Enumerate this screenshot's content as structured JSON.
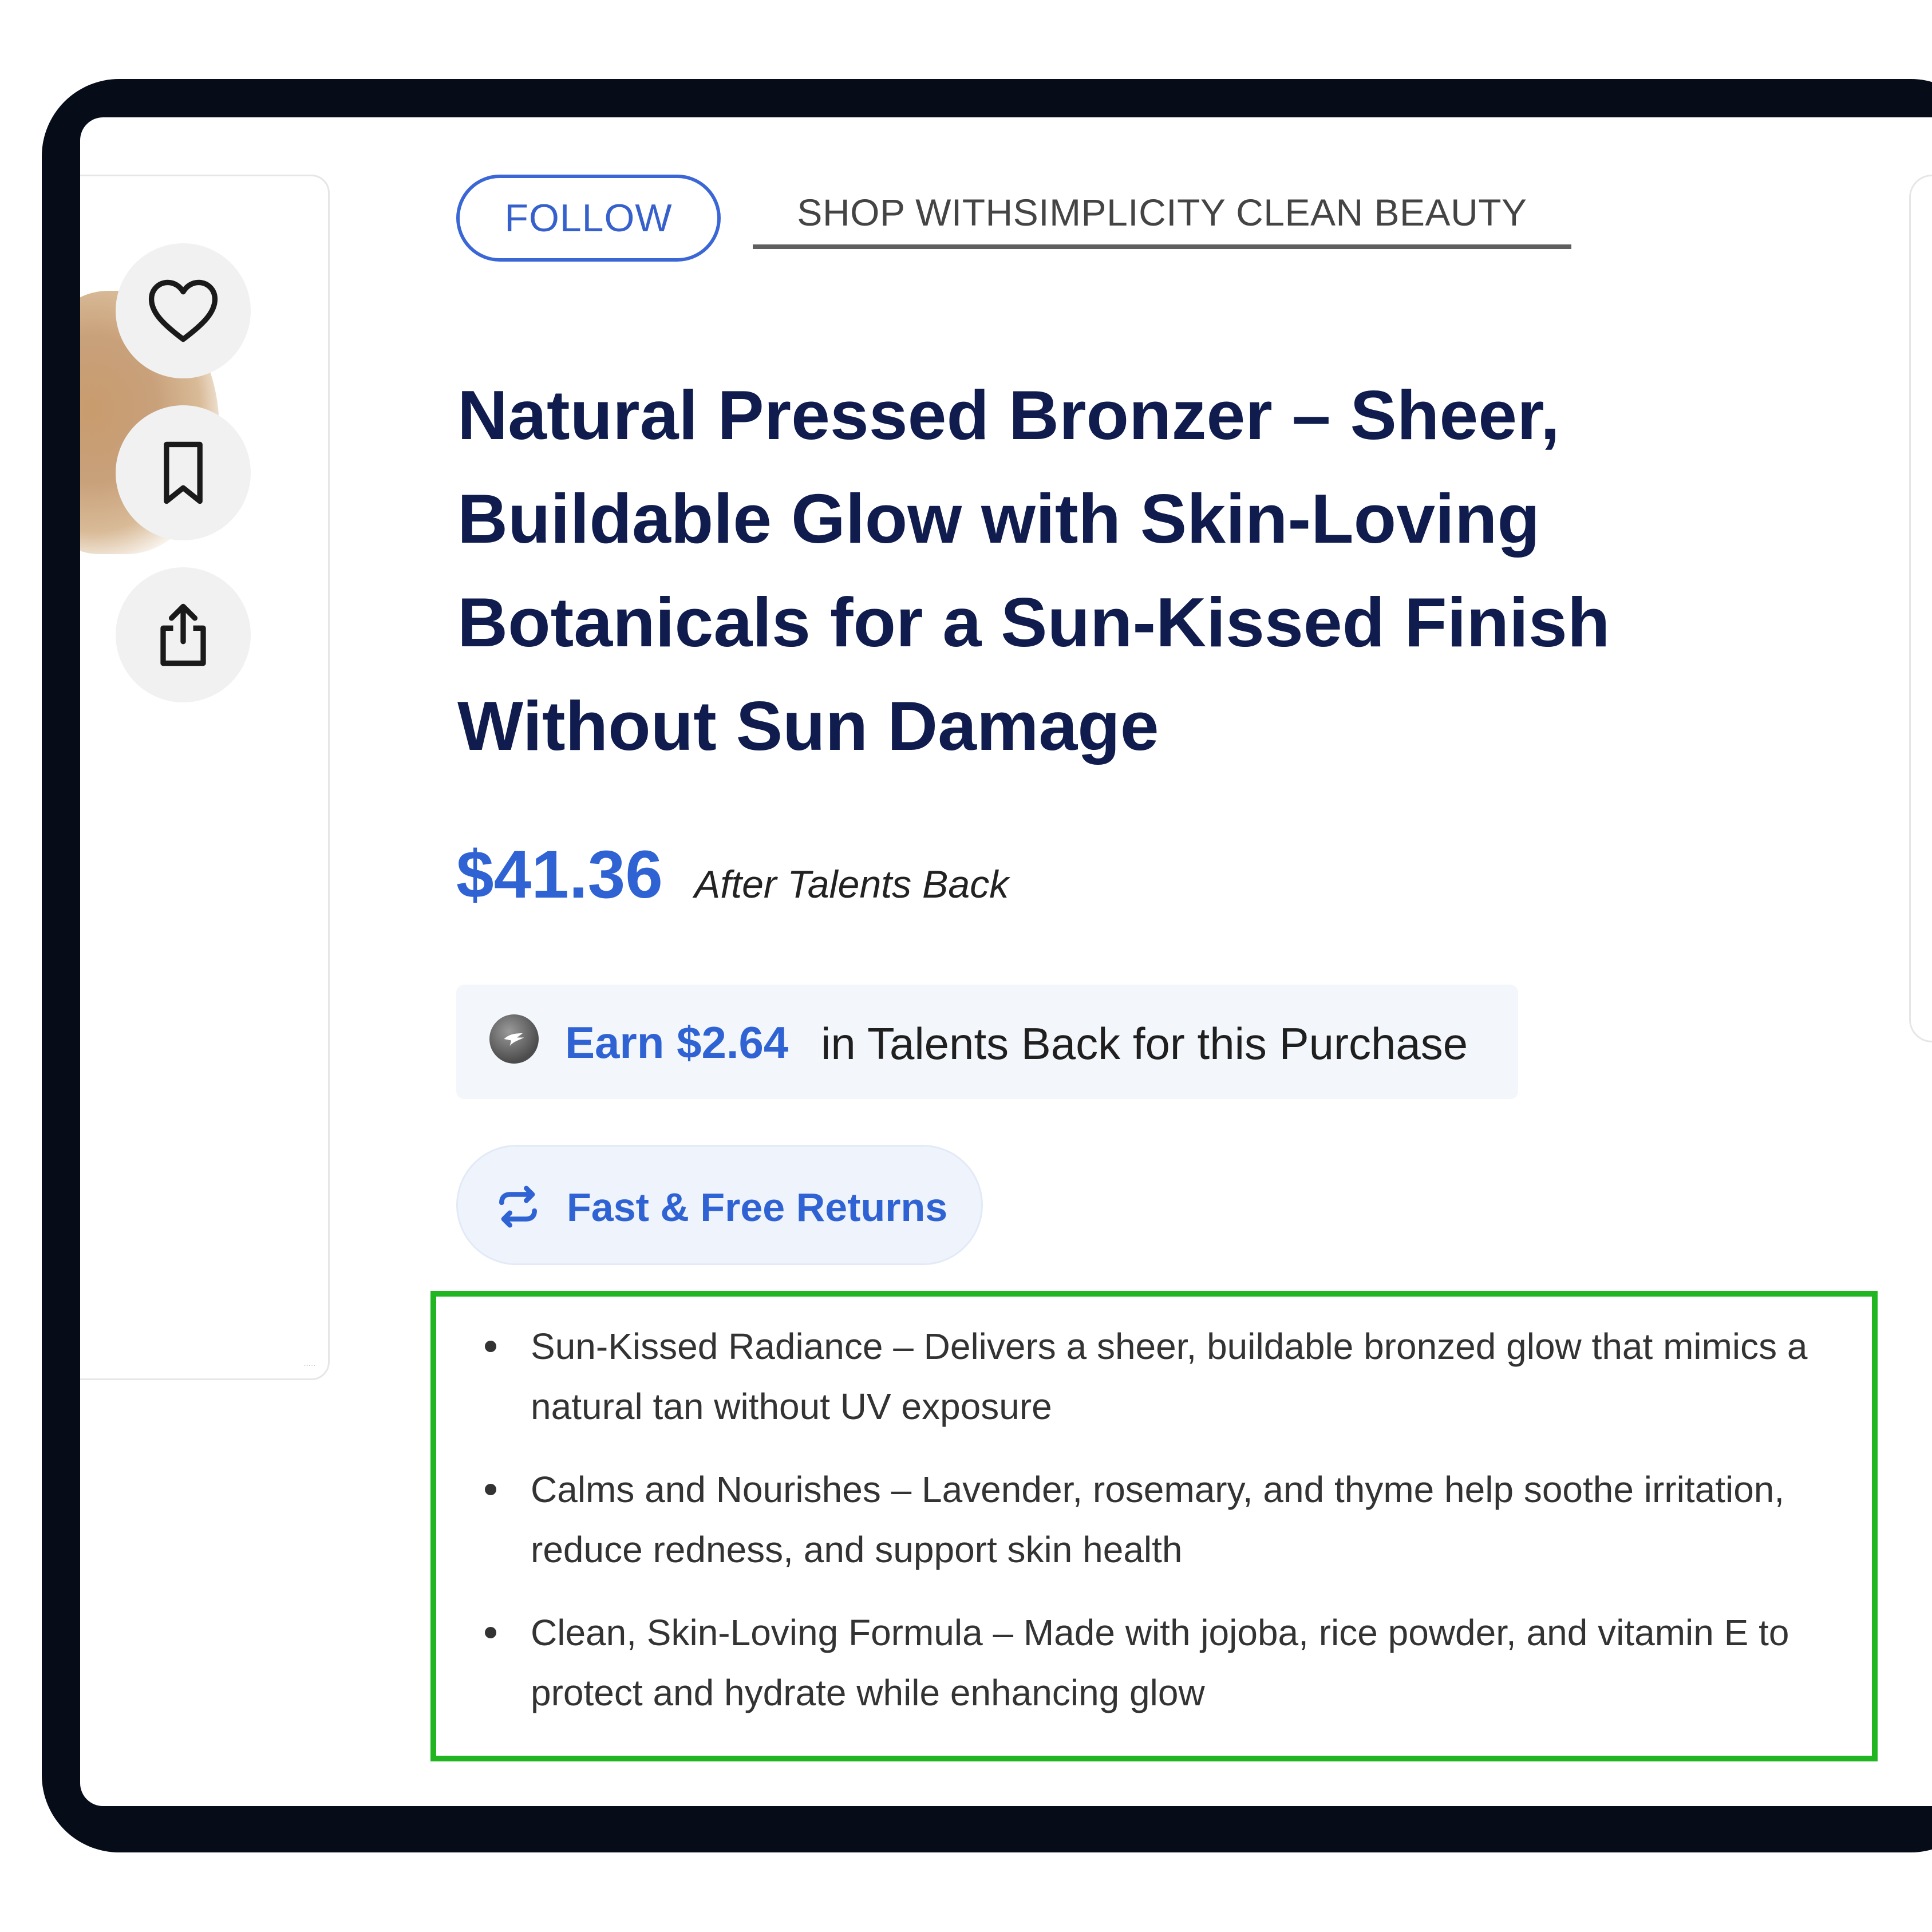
{
  "product": {
    "follow_label": "FOLLOW",
    "shop_link": "SHOP WITHSIMPLICITY CLEAN BEAUTY",
    "title": "Natural Pressed Bronzer – Sheer, Buildable Glow with Skin-Loving Botanicals for a Sun-Kissed Finish Without Sun Damage",
    "price": "$41.36",
    "price_note": "After Talents Back",
    "earn": {
      "highlight": "Earn $2.64",
      "rest": "in Talents Back for this Purchase"
    },
    "returns_label": "Fast & Free Returns",
    "features": [
      "Sun-Kissed Radiance – Delivers a sheer, buildable bronzed glow that mimics a natural tan without UV exposure",
      "Calms and Nourishes – Lavender, rosemary, and thyme help soothe irritation, reduce redness, and support skin health",
      "Clean, Skin-Loving Formula – Made with jojoba, rice powder, and vitamin E to protect and hydrate while enhancing glow"
    ]
  },
  "image_actions": {
    "icons": [
      "heart-icon",
      "bookmark-icon",
      "share-icon"
    ]
  },
  "colors": {
    "accent_blue": "#2f62d3",
    "title_navy": "#0f1c4d",
    "highlight_green": "#22b522",
    "device_frame": "#060c18"
  }
}
